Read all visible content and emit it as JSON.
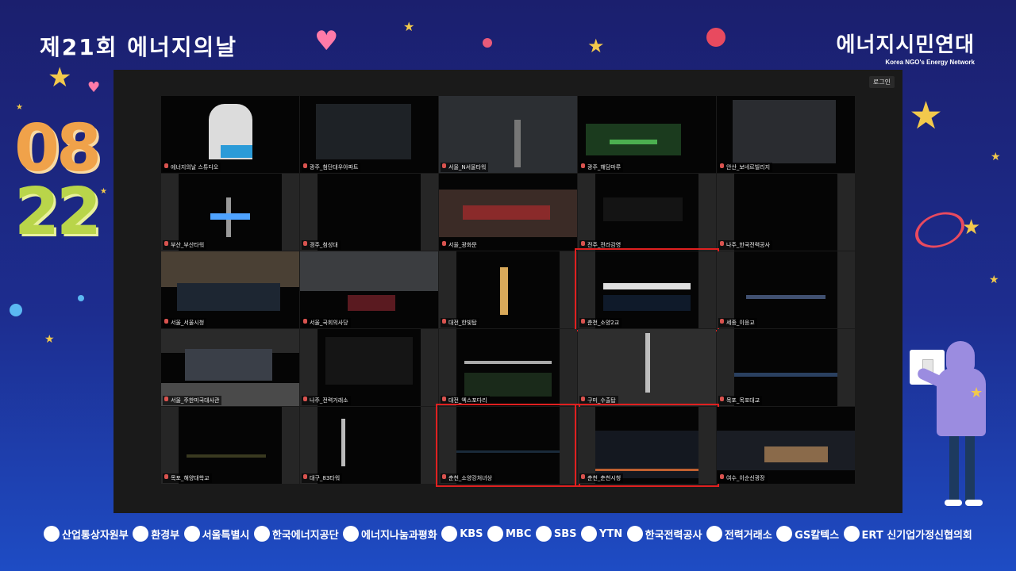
{
  "event": {
    "title": "제21회 에너지의날",
    "date_month": "08",
    "date_day": "22"
  },
  "organizer": {
    "name": "에너지시민연대",
    "subtitle": "Korea NGO's Energy Network"
  },
  "window": {
    "login_button": "로그인"
  },
  "participants": [
    {
      "label": "에너지의날 스튜디오",
      "speaker": true,
      "highlight": false,
      "layout": "full"
    },
    {
      "label": "광주_첨단대우아파트",
      "speaker": false,
      "highlight": false,
      "layout": "full"
    },
    {
      "label": "서울_N서울타워",
      "speaker": false,
      "highlight": false,
      "layout": "full"
    },
    {
      "label": "광주_해담마루",
      "speaker": false,
      "highlight": false,
      "layout": "full"
    },
    {
      "label": "안산_보네르빌리지",
      "speaker": false,
      "highlight": false,
      "layout": "full"
    },
    {
      "label": "부산_부산타워",
      "speaker": false,
      "highlight": false,
      "layout": "narrow"
    },
    {
      "label": "경주_첨성대",
      "speaker": false,
      "highlight": false,
      "layout": "narrow"
    },
    {
      "label": "서울_광화문",
      "speaker": false,
      "highlight": false,
      "layout": "full"
    },
    {
      "label": "전주_전라감영",
      "speaker": false,
      "highlight": false,
      "layout": "narrow"
    },
    {
      "label": "나주_한국전력공사",
      "speaker": false,
      "highlight": false,
      "layout": "narrow"
    },
    {
      "label": "서울_서울시청",
      "speaker": false,
      "highlight": false,
      "layout": "full"
    },
    {
      "label": "서울_국회의사당",
      "speaker": false,
      "highlight": false,
      "layout": "full"
    },
    {
      "label": "대전_한빛탑",
      "speaker": false,
      "highlight": false,
      "layout": "narrow"
    },
    {
      "label": "춘천_소양2교",
      "speaker": false,
      "highlight": true,
      "layout": "narrow"
    },
    {
      "label": "세종_이응교",
      "speaker": false,
      "highlight": false,
      "layout": "narrow"
    },
    {
      "label": "서울_주한미국대사관",
      "speaker": false,
      "highlight": false,
      "layout": "full"
    },
    {
      "label": "나주_전력거래소",
      "speaker": false,
      "highlight": false,
      "layout": "narrow"
    },
    {
      "label": "대전_엑스포다리",
      "speaker": false,
      "highlight": false,
      "layout": "narrow"
    },
    {
      "label": "구미_수출탑",
      "speaker": false,
      "highlight": false,
      "layout": "full"
    },
    {
      "label": "목포_목포대교",
      "speaker": false,
      "highlight": false,
      "layout": "narrow"
    },
    {
      "label": "목포_해양대학교",
      "speaker": false,
      "highlight": false,
      "layout": "narrow"
    },
    {
      "label": "대구_83타워",
      "speaker": false,
      "highlight": false,
      "layout": "narrow"
    },
    {
      "label": "춘천_소양강처녀상",
      "speaker": false,
      "highlight": true,
      "layout": "narrow"
    },
    {
      "label": "춘천_춘천시청",
      "speaker": false,
      "highlight": true,
      "layout": "narrow"
    },
    {
      "label": "여수_이순신광장",
      "speaker": false,
      "highlight": false,
      "layout": "full"
    }
  ],
  "sponsors": [
    "산업통상자원부",
    "환경부",
    "서울특별시",
    "한국에너지공단",
    "에너지나눔과평화",
    "KBS",
    "MBC",
    "SBS",
    "YTN",
    "한국전력공사",
    "전력거래소",
    "GS칼텍스",
    "ERT 신기업가정신협의회"
  ],
  "colors": {
    "background_top": "#1b1f6e",
    "background_bottom": "#1e4cc4",
    "speaker_border": "#3ecf5a",
    "highlight_border": "#e02020",
    "date_month": "#f0a24a",
    "date_day": "#b9d54a"
  }
}
